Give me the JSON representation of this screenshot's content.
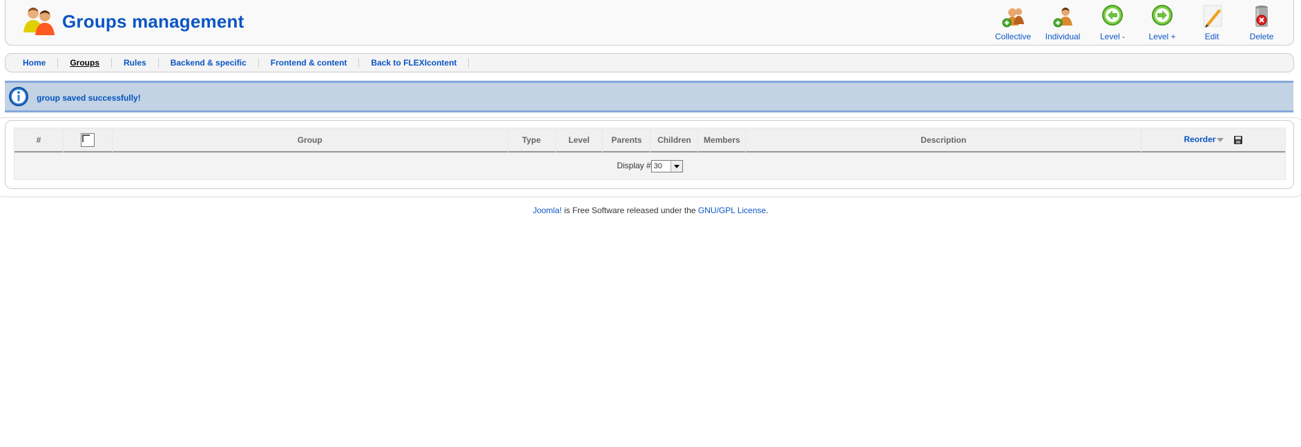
{
  "header": {
    "title": "Groups management",
    "icon": "groups-icon"
  },
  "toolbar": {
    "buttons": [
      {
        "label": "Collective",
        "icon": "collective-add-icon"
      },
      {
        "label": "Individual",
        "icon": "individual-add-icon"
      },
      {
        "label": "Level -",
        "icon": "level-down-icon"
      },
      {
        "label": "Level +",
        "icon": "level-up-icon"
      },
      {
        "label": "Edit",
        "icon": "pencil-icon"
      },
      {
        "label": "Delete",
        "icon": "trash-icon"
      }
    ]
  },
  "submenu": {
    "items": [
      {
        "label": "Home"
      },
      {
        "label": "Groups",
        "active": true
      },
      {
        "label": "Rules"
      },
      {
        "label": "Backend & specific"
      },
      {
        "label": "Frontend & content"
      },
      {
        "label": "Back to FLEXIcontent"
      }
    ]
  },
  "message": {
    "text": "group saved successfully!",
    "icon": "info-icon"
  },
  "table": {
    "columns": [
      "#",
      "",
      "Group",
      "Type",
      "Level",
      "Parents",
      "Children",
      "Members",
      "Description",
      "Reorder"
    ],
    "rows": [],
    "footer": {
      "display_label": "Display #",
      "limit_value": "30"
    }
  },
  "page_footer": {
    "joomla_link": "Joomla!",
    "middle_text": " is Free Software released under the ",
    "license_link": "GNU/GPL License",
    "end_text": "."
  },
  "colors": {
    "accent": "#0B55C4",
    "message_bg": "#C3D2E5",
    "message_border": "#84A7DB"
  }
}
